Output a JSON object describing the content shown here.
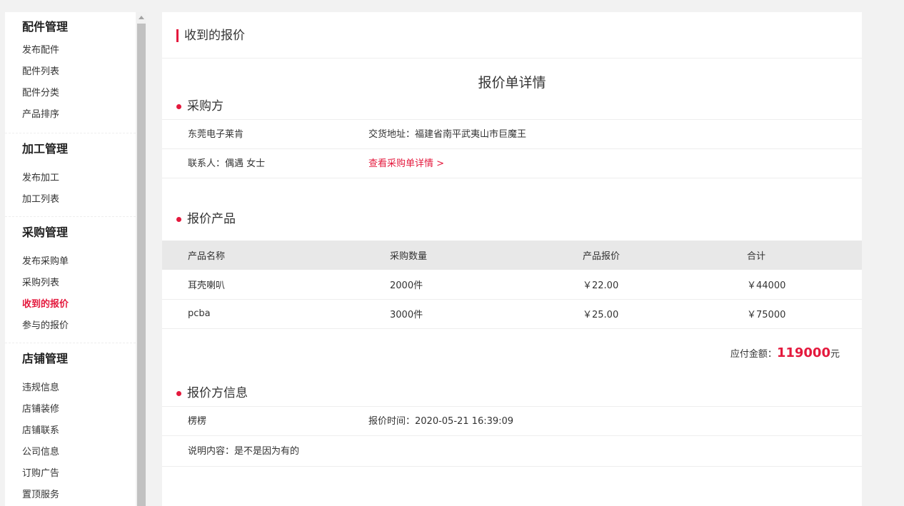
{
  "sidebar": {
    "groups": [
      {
        "title": "配件管理",
        "items": [
          "发布配件",
          "配件列表",
          "配件分类",
          "产品排序"
        ]
      },
      {
        "title": "加工管理",
        "items": [
          "发布加工",
          "加工列表"
        ]
      },
      {
        "title": "采购管理",
        "items": [
          "发布采购单",
          "采购列表",
          "收到的报价",
          "参与的报价"
        ]
      },
      {
        "title": "店铺管理",
        "items": [
          "违规信息",
          "店铺装修",
          "店铺联系",
          "公司信息",
          "订购广告",
          "置顶服务"
        ]
      }
    ],
    "active_item": "收到的报价"
  },
  "page": {
    "title": "收到的报价",
    "detail_title": "报价单详情"
  },
  "buyer": {
    "section_label": "采购方",
    "company": "东莞电子莱肯",
    "address": "交货地址：福建省南平武夷山市巨魔王",
    "contact": "联系人：偶遇 女士",
    "view_link": "查看采购单详情 >"
  },
  "products": {
    "section_label": "报价产品",
    "columns": [
      "产品名称",
      "采购数量",
      "产品报价",
      "合计"
    ],
    "rows": [
      [
        "耳壳喇叭",
        "2000件",
        "￥22.00",
        "￥44000"
      ],
      [
        "pcba",
        "3000件",
        "￥25.00",
        "￥75000"
      ]
    ],
    "total_label": "应付金额：",
    "total_amount": "119000",
    "total_unit": "元"
  },
  "quoter": {
    "section_label": "报价方信息",
    "name": "楞楞",
    "quote_time": "报价时间：2020-05-21 16:39:09",
    "description": "说明内容：是不是因为有的"
  },
  "colors": {
    "accent": "#e4193d"
  }
}
